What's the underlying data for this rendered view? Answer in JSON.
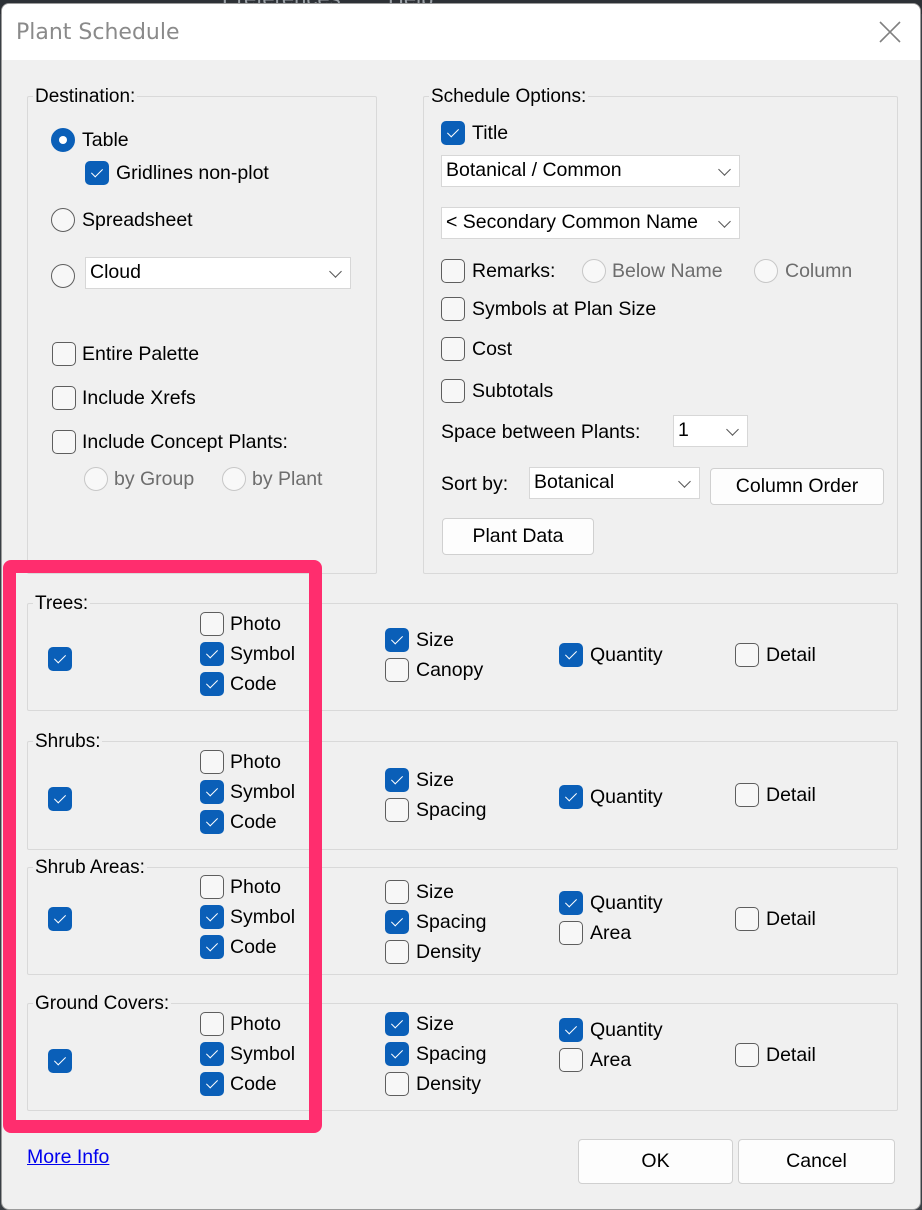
{
  "background": {
    "menu_items": [
      "Preferences",
      "Help"
    ]
  },
  "dialog": {
    "title": "Plant Schedule",
    "close_icon": "close-x-icon"
  },
  "destination": {
    "label": "Destination:",
    "table_label": "Table",
    "table_selected": true,
    "gridlines_label": "Gridlines non-plot",
    "gridlines_checked": true,
    "spreadsheet_label": "Spreadsheet",
    "spreadsheet_selected": false,
    "cloud_selected": false,
    "cloud_value": "Cloud",
    "entire_palette_label": "Entire Palette",
    "entire_palette_checked": false,
    "include_xrefs_label": "Include Xrefs",
    "include_xrefs_checked": false,
    "include_concept_label": "Include Concept Plants:",
    "include_concept_checked": false,
    "by_group_label": "by Group",
    "by_plant_label": "by Plant"
  },
  "schedule_options": {
    "label": "Schedule Options:",
    "title_label": "Title",
    "title_checked": true,
    "name_format_value": "Botanical / Common",
    "secondary_value": "< Secondary Common Name",
    "remarks_label": "Remarks:",
    "remarks_checked": false,
    "below_name_label": "Below Name",
    "column_label": "Column",
    "symbols_label": "Symbols at Plan Size",
    "symbols_checked": false,
    "cost_label": "Cost",
    "cost_checked": false,
    "subtotals_label": "Subtotals",
    "subtotals_checked": false,
    "space_label": "Space between Plants:",
    "space_value": "1",
    "sort_label": "Sort by:",
    "sort_value": "Botanical",
    "column_order_button": "Column Order",
    "plant_data_button": "Plant Data"
  },
  "categories": [
    {
      "label": "Trees:",
      "enabled": true,
      "photo": false,
      "symbol": true,
      "code": true,
      "col2": [
        {
          "label": "Size",
          "checked": true
        },
        {
          "label": "Canopy",
          "checked": false
        }
      ],
      "col3": [
        {
          "label": "Quantity",
          "checked": true
        }
      ],
      "detail": false
    },
    {
      "label": "Shrubs:",
      "enabled": true,
      "photo": false,
      "symbol": true,
      "code": true,
      "col2": [
        {
          "label": "Size",
          "checked": true
        },
        {
          "label": "Spacing",
          "checked": false
        }
      ],
      "col3": [
        {
          "label": "Quantity",
          "checked": true
        }
      ],
      "detail": false
    },
    {
      "label": "Shrub Areas:",
      "enabled": true,
      "photo": false,
      "symbol": true,
      "code": true,
      "col2": [
        {
          "label": "Size",
          "checked": false
        },
        {
          "label": "Spacing",
          "checked": true
        },
        {
          "label": "Density",
          "checked": false
        }
      ],
      "col3": [
        {
          "label": "Quantity",
          "checked": true
        },
        {
          "label": "Area",
          "checked": false
        }
      ],
      "detail": false
    },
    {
      "label": "Ground Covers:",
      "enabled": true,
      "photo": false,
      "symbol": true,
      "code": true,
      "col2": [
        {
          "label": "Size",
          "checked": true
        },
        {
          "label": "Spacing",
          "checked": true
        },
        {
          "label": "Density",
          "checked": false
        }
      ],
      "col3": [
        {
          "label": "Quantity",
          "checked": true
        },
        {
          "label": "Area",
          "checked": false
        }
      ],
      "detail": false
    }
  ],
  "common_labels": {
    "photo": "Photo",
    "symbol": "Symbol",
    "code": "Code",
    "detail": "Detail"
  },
  "footer": {
    "more_info_link": "More Info",
    "ok_button": "OK",
    "cancel_button": "Cancel"
  },
  "colors": {
    "accent": "#0a5fb8",
    "highlight": "#ff2d6e",
    "link": "#0000ee"
  }
}
